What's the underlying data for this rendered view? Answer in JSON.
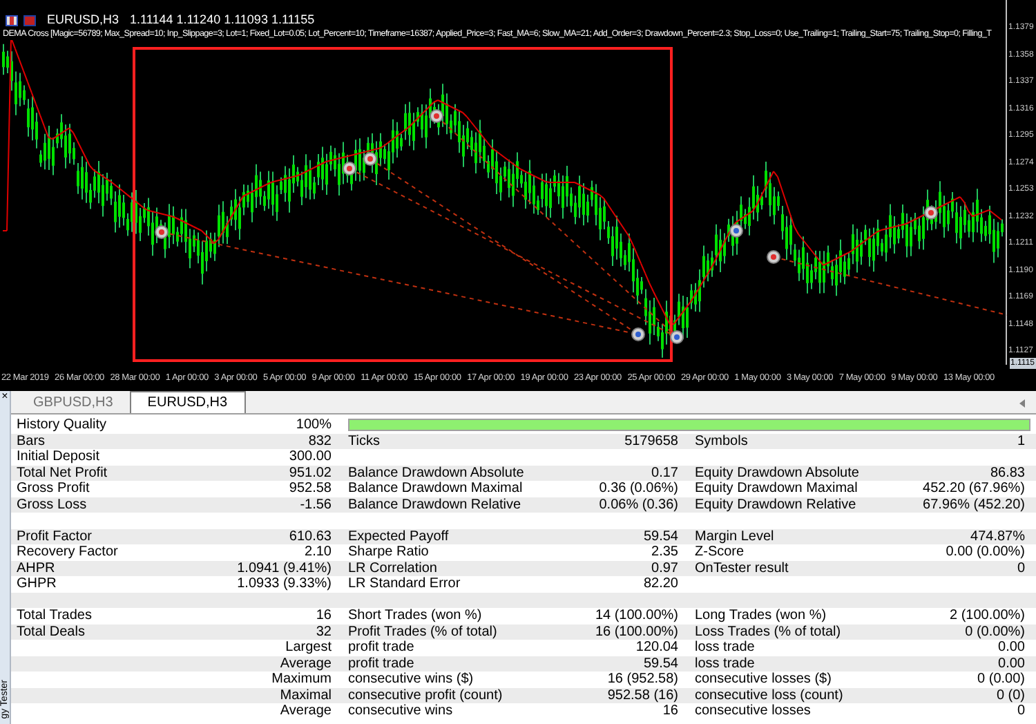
{
  "chart": {
    "symbol": "EURUSD,H3",
    "quote": "1.11144 1.11240 1.11093 1.11155",
    "expert": "DEMA Cross [Magic=56789; Max_Spread=10; Inp_Slippage=3; Lot=1; Fixed_Lot=0.05; Lot_Percent=10; Timeframe=16387; Applied_Price=3; Fast_MA=6; Slow_MA=21; Add_Order=3; Drawdown_Percent=2.3; Stop_Loss=0; Use_Trailing=1; Trailing_Start=75; Trailing_Stop=0; Filling_T",
    "price_axis": [
      "1.1379",
      "1.1358",
      "1.1337",
      "1.1316",
      "1.1295",
      "1.1274",
      "1.1253",
      "1.1232",
      "1.1211",
      "1.1190",
      "1.1169",
      "1.1148",
      "1.1127"
    ],
    "current_price": "1.1115",
    "time_axis": [
      "22 Mar 2019",
      "26 Mar 00:00",
      "28 Mar 00:00",
      "1 Apr 00:00",
      "3 Apr 00:00",
      "5 Apr 00:00",
      "9 Apr 00:00",
      "11 Apr 00:00",
      "15 Apr 00:00",
      "17 Apr 00:00",
      "19 Apr 00:00",
      "23 Apr 00:00",
      "25 Apr 00:00",
      "29 Apr 00:00",
      "1 May 00:00",
      "3 May 00:00",
      "7 May 00:00",
      "9 May 00:00",
      "13 May 00:00"
    ]
  },
  "tabs": [
    {
      "label": "GBPUSD,H3",
      "selected": false
    },
    {
      "label": "EURUSD,H3",
      "selected": true
    }
  ],
  "side_panel": {
    "close": "×",
    "title": "gy Tester"
  },
  "report": [
    {
      "kind": "quality",
      "label_1": "History Quality",
      "value_1": "100%",
      "level": 1
    },
    {
      "kind": "stats",
      "label_1": "Bars",
      "value_1": "832",
      "label_2": "Ticks",
      "value_2": "5179658",
      "label_3": "Symbols",
      "value_3": "1"
    },
    {
      "kind": "stats",
      "label_1": "Initial Deposit",
      "value_1": "300.00"
    },
    {
      "kind": "stats",
      "label_1": "Total Net Profit",
      "value_1": "951.02",
      "label_2": "Balance Drawdown Absolute",
      "value_2": "0.17",
      "label_3": "Equity Drawdown Absolute",
      "value_3": "86.83"
    },
    {
      "kind": "stats",
      "label_1": "Gross Profit",
      "value_1": "952.58",
      "label_2": "Balance Drawdown Maximal",
      "value_2": "0.36 (0.06%)",
      "label_3": "Equity Drawdown Maximal",
      "value_3": "452.20 (67.96%)"
    },
    {
      "kind": "stats",
      "label_1": "Gross Loss",
      "value_1": "-1.56",
      "label_2": "Balance Drawdown Relative",
      "value_2": "0.06% (0.36)",
      "label_3": "Equity Drawdown Relative",
      "value_3": "67.96% (452.20)"
    },
    {
      "kind": "blank"
    },
    {
      "kind": "stats",
      "label_1": "Profit Factor",
      "value_1": "610.63",
      "label_2": "Expected Payoff",
      "value_2": "59.54",
      "label_3": "Margin Level",
      "value_3": "474.87%"
    },
    {
      "kind": "stats",
      "label_1": "Recovery Factor",
      "value_1": "2.10",
      "label_2": "Sharpe Ratio",
      "value_2": "2.35",
      "label_3": "Z-Score",
      "value_3": "0.00 (0.00%)"
    },
    {
      "kind": "stats",
      "label_1": "AHPR",
      "value_1": "1.0941 (9.41%)",
      "label_2": "LR Correlation",
      "value_2": "0.97",
      "label_3": "OnTester result",
      "value_3": "0"
    },
    {
      "kind": "stats",
      "label_1": "GHPR",
      "value_1": "1.0933 (9.33%)",
      "label_2": "LR Standard Error",
      "value_2": "82.20"
    },
    {
      "kind": "blank"
    },
    {
      "kind": "stats",
      "label_1": "Total Trades",
      "value_1": "16",
      "label_2": "Short Trades (won %)",
      "value_2": "14 (100.00%)",
      "label_3": "Long Trades (won %)",
      "value_3": "2 (100.00%)"
    },
    {
      "kind": "stats",
      "label_1": "Total Deals",
      "value_1": "32",
      "label_2": "Profit Trades (% of total)",
      "value_2": "16 (100.00%)",
      "label_3": "Loss Trades (% of total)",
      "value_3": "0 (0.00%)"
    },
    {
      "kind": "stats",
      "value_1": "Largest",
      "label_2": "profit trade",
      "value_2": "120.04",
      "label_3": "loss trade",
      "value_3": "0.00"
    },
    {
      "kind": "stats",
      "value_1": "Average",
      "label_2": "profit trade",
      "value_2": "59.54",
      "label_3": "loss trade",
      "value_3": "0.00"
    },
    {
      "kind": "stats",
      "value_1": "Maximum",
      "label_2": "consecutive wins ($)",
      "value_2": "16 (952.58)",
      "label_3": "consecutive losses ($)",
      "value_3": "0 (0.00)"
    },
    {
      "kind": "stats",
      "value_1": "Maximal",
      "label_2": "consecutive profit (count)",
      "value_2": "952.58 (16)",
      "label_3": "consecutive loss (count)",
      "value_3": "0 (0)"
    },
    {
      "kind": "stats",
      "value_1": "Average",
      "label_2": "consecutive wins",
      "value_2": "16",
      "label_3": "consecutive losses",
      "value_3": "0"
    }
  ]
}
